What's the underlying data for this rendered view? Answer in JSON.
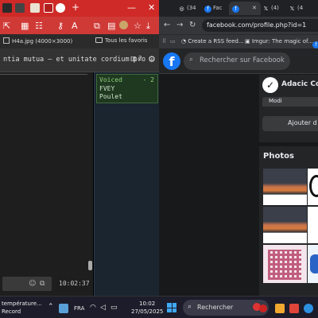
{
  "left_browser": {
    "window_controls": {
      "minimize": "—",
      "close": "✕"
    },
    "bookmarks": {
      "image_link": "H4a.jpg (4000×3000)",
      "all_favorites": "Tous les favoris"
    },
    "chat": {
      "title": "ntia mutua — et unitate cordium pro …",
      "user_count": "2",
      "voiced": {
        "label": "Voiced",
        "count": "- 2",
        "users": [
          "FVEY",
          "Poulet"
        ]
      },
      "time": "10:02:37"
    }
  },
  "right_browser": {
    "tabs": [
      {
        "label": "(34",
        "icon": "browser-icon"
      },
      {
        "label": "Fac",
        "icon": "facebook-icon"
      },
      {
        "label": "",
        "icon": "facebook-icon"
      },
      {
        "label": "(4)",
        "icon": "x-icon"
      },
      {
        "label": "(4",
        "icon": "x-icon"
      }
    ],
    "url": "facebook.com/profile.php?id=1",
    "bookmarks": [
      "Create a RSS feed...",
      "Imgur: The magic of..."
    ],
    "facebook": {
      "search_placeholder": "Rechercher sur Facebook",
      "app_name": "Adacic Cov",
      "modify_label": "Modi",
      "add_label": "Ajouter d",
      "photos_title": "Photos"
    }
  },
  "taskbar": {
    "weather": "température...",
    "weather_sub": "Record",
    "language": "FRA",
    "time": "10:02",
    "date": "27/05/2025",
    "search_label": "Rechercher"
  }
}
